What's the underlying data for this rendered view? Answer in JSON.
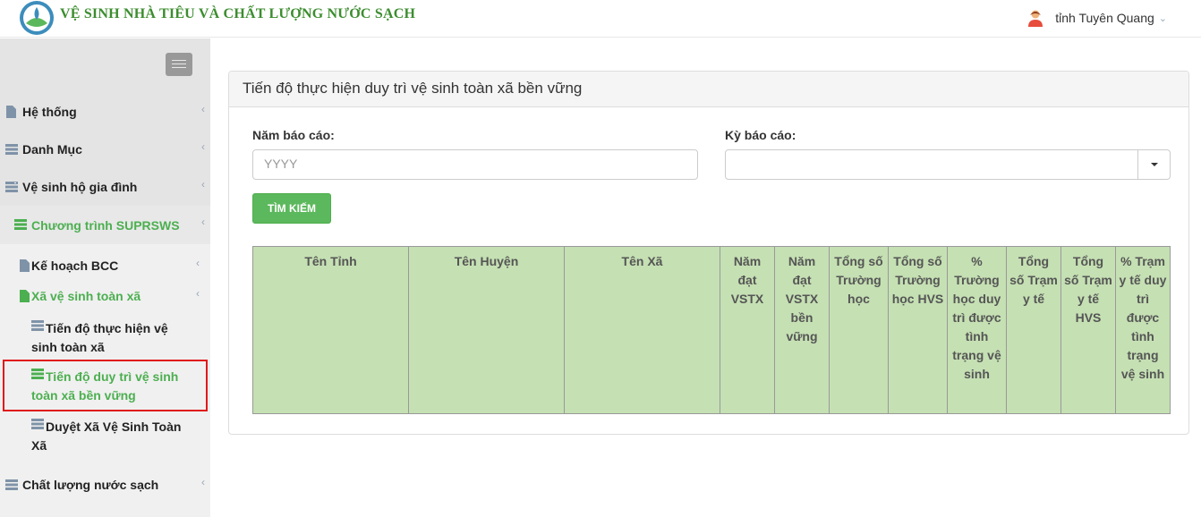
{
  "app": {
    "title": "VỆ SINH NHÀ TIÊU VÀ CHẤT LƯỢNG NƯỚC SẠCH",
    "logo_icon": "logo-icon"
  },
  "user": {
    "name": "tỉnh Tuyên Quang",
    "avatar_icon": "user-avatar-icon",
    "chevron": "⌄"
  },
  "sidebar": {
    "items": [
      {
        "label": "Hệ thống",
        "icon": "file-icon"
      },
      {
        "label": "Danh Mục",
        "icon": "list-icon"
      },
      {
        "label": "Vệ sinh hộ gia đình",
        "icon": "server-icon"
      },
      {
        "label": "Chương trình SUPRSWS",
        "icon": "server-icon"
      },
      {
        "label": "Kế hoạch BCC",
        "icon": "file-icon"
      },
      {
        "label": "Xã vệ sinh toàn xã",
        "icon": "file-icon"
      },
      {
        "label": "Tiến độ thực hiện vệ sinh toàn xã",
        "icon": "list-icon"
      },
      {
        "label": "Tiến độ duy trì vệ sinh toàn xã bền vững",
        "icon": "server-icon"
      },
      {
        "label": "Duyệt Xã Vệ Sinh Toàn Xã",
        "icon": "list-icon"
      },
      {
        "label": "Chất lượng nước sạch",
        "icon": "server-icon"
      }
    ],
    "arrow": "‹",
    "active_color": "#4caf50"
  },
  "panel": {
    "title": "Tiến độ thực hiện duy trì vệ sinh toàn xã bền vững",
    "year_label": "Năm báo cáo:",
    "year_placeholder": "YYYY",
    "period_label": "Kỳ báo cáo:",
    "period_value": "",
    "search_button": "TÌM KIẾM"
  },
  "table": {
    "headers": [
      "Tên Tỉnh",
      "Tên Huyện",
      "Tên Xã",
      "Năm đạt VSTX",
      "Năm đạt VSTX bền vững",
      "Tổng số Trường học",
      "Tổng số Trường học HVS",
      "% Trường học duy trì được tình trạng vệ sinh",
      "Tổng số Trạm y tế",
      "Tổng số Trạm y tế HVS",
      "% Trạm y tế duy trì được tình trạng vệ sinh"
    ],
    "header_bg": "#c5e0b3"
  }
}
